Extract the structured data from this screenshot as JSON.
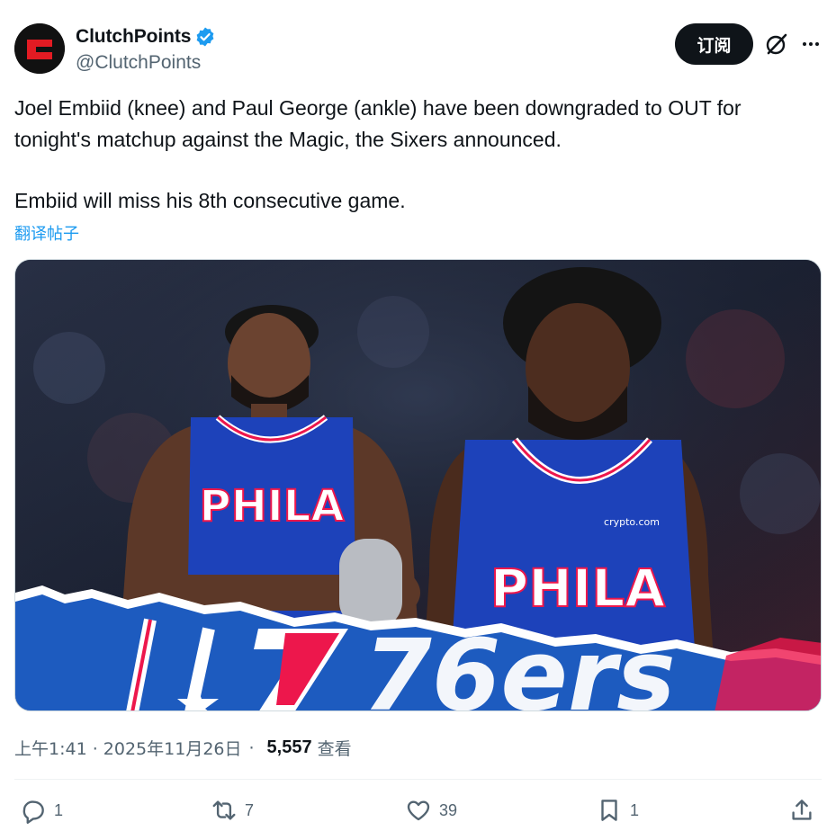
{
  "author": {
    "display_name": "ClutchPoints",
    "handle": "@ClutchPoints",
    "verified": true,
    "avatar_letter": "C",
    "brand_color": "#e31b23"
  },
  "header": {
    "subscribe_label": "订阅",
    "grok_icon": "grok-icon",
    "more_icon": "more-icon"
  },
  "tweet": {
    "line1": "Joel Embiid (knee) and Paul George (ankle) have been downgraded to OUT for tonight's matchup against the Magic, the Sixers announced.",
    "line2": "Embiid will miss his 8th consecutive game.",
    "translate_label": "翻译帖子"
  },
  "media": {
    "jersey_text_left": "PHILA",
    "jersey_text_right": "PHILA",
    "sponsor": "crypto.com",
    "banner_text": "76ers",
    "team_colors": {
      "blue": "#1d42ba",
      "red": "#ed174c",
      "white": "#ffffff"
    }
  },
  "meta": {
    "timestamp": "上午1:41 · 2025年11月26日",
    "views_count": "5,557",
    "views_label": "查看"
  },
  "actions": {
    "replies": "1",
    "reposts": "7",
    "likes": "39",
    "bookmarks": "1"
  }
}
